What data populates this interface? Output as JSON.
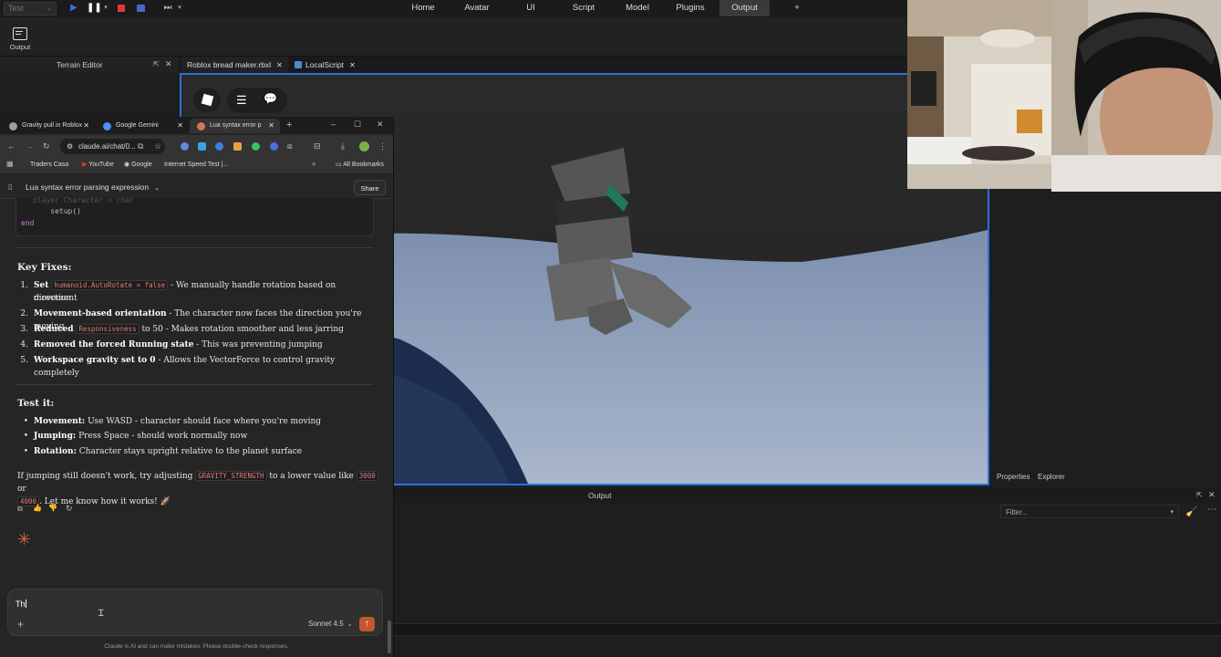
{
  "studio": {
    "test_mode": "Test",
    "menu_tabs": [
      "Home",
      "Avatar",
      "UI",
      "Script",
      "Model",
      "Plugins",
      "Output",
      "+"
    ],
    "active_tab": "Output",
    "ribbon_output_label": "Output",
    "terrain_editor_label": "Terrain Editor",
    "doc_tabs": [
      "Roblox bread maker.rbxl",
      "LocalScript"
    ],
    "properties_tabs": [
      "Properties",
      "Explorer"
    ],
    "output_panel_title": "Output",
    "filter_placeholder": "Filter..."
  },
  "browser": {
    "tabs": [
      {
        "label": "Gravity pull in Roblox",
        "color": "#9aa0a6"
      },
      {
        "label": "Google Gemini",
        "color": "#4f8ef7"
      },
      {
        "label": "Lua syntax error p",
        "color": "#cc785c"
      }
    ],
    "url": "claude.ai/chat/0...",
    "bookmarks": [
      "Traders Casa",
      "YouTube",
      "Google",
      "Internet Speed Test |...",
      "All Bookmarks"
    ]
  },
  "chat": {
    "title": "Lua syntax error parsing expression",
    "share_label": "Share",
    "code_lines": [
      "  player.Character = char",
      "    setup()",
      "end"
    ],
    "key_fixes_heading": "Key Fixes:",
    "fixes": [
      {
        "num": "1.",
        "bold": "Set",
        "code": "humanoid.AutoRotate = false",
        "text": " - We manually handle rotation based on movement",
        "cont": "direction"
      },
      {
        "num": "2.",
        "bold": "Movement-based orientation",
        "text": " - The character now faces the direction you're moving"
      },
      {
        "num": "3.",
        "bold": "Reduced",
        "code": "Responsiveness",
        "text": " to 50 - Makes rotation smoother and less jarring"
      },
      {
        "num": "4.",
        "bold": "Removed the forced Running state",
        "text": " - This was preventing jumping"
      },
      {
        "num": "5.",
        "bold": "Workspace gravity set to 0",
        "text": " - Allows the VectorForce to control gravity completely"
      }
    ],
    "test_heading": "Test it:",
    "tests": [
      {
        "bold": "Movement:",
        "text": " Use WASD - character should face where you're moving"
      },
      {
        "bold": "Jumping:",
        "text": " Press Space - should work normally now"
      },
      {
        "bold": "Rotation:",
        "text": " Character stays upright relative to the planet surface"
      }
    ],
    "closing_pre": "If jumping still doesn't work, try adjusting",
    "closing_code1": "GRAVITY_STRENGTH",
    "closing_mid": "to a lower value like",
    "closing_code2": "3000",
    "closing_or": "or",
    "closing_code3": "4000",
    "closing_end": ". Let me know how it works! 🚀",
    "input_value": "Th",
    "model_label": "Sonnet 4.5",
    "disclaimer": "Claude is AI and can make mistakes. Please double-check responses."
  },
  "colors": {
    "accent_blue": "#2e6fd8",
    "claude_orange": "#c4572e",
    "code_red": "#e07a7a"
  }
}
